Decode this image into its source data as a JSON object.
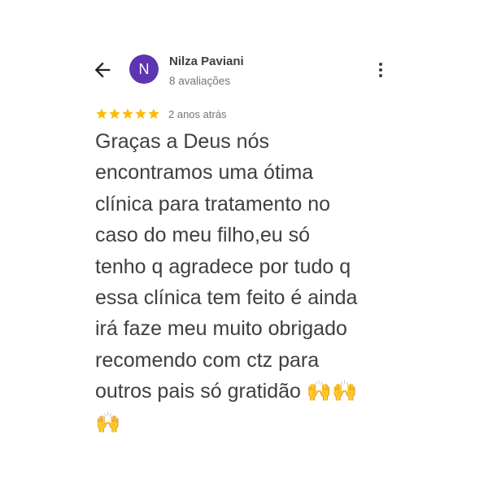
{
  "header": {
    "avatar_letter": "N",
    "avatar_color": "#5e35b1",
    "reviewer_name": "Nilza Paviani",
    "review_count": "8 avaliações",
    "back_icon": "arrow-back-icon",
    "more_icon": "more-vert-icon"
  },
  "review": {
    "rating": 5,
    "star_color": "#fbbc04",
    "date": "2 anos atrás",
    "text": "Graças a Deus nós\nencontramos uma ótima\nclínica para tratamento no\ncaso do meu filho,eu só\ntenho q agradece por tudo q\nessa clínica tem feito é ainda\nirá faze meu muito obrigado\nrecomendo com ctz para\noutros pais só gratidão 🙌🙌\n🙌"
  }
}
